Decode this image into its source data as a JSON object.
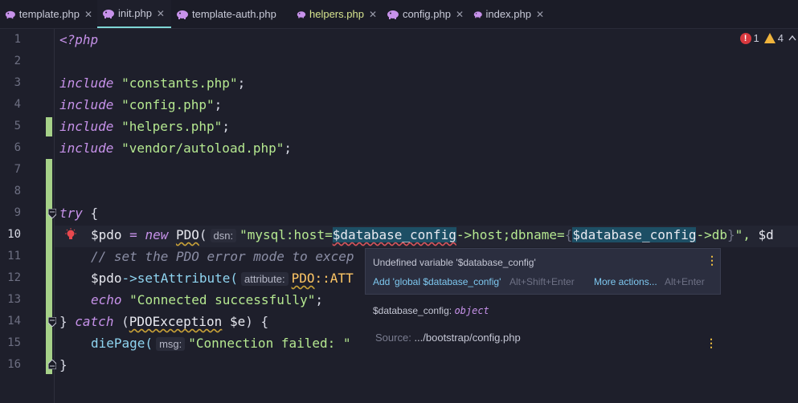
{
  "tabs": [
    {
      "label": "template.php",
      "active": false,
      "modified": false
    },
    {
      "label": "init.php",
      "active": true,
      "modified": false
    },
    {
      "label": "template-auth.php",
      "active": false,
      "modified": false
    },
    {
      "label": "helpers.php",
      "active": false,
      "modified": true
    },
    {
      "label": "config.php",
      "active": false,
      "modified": false
    },
    {
      "label": "index.php",
      "active": false,
      "modified": false
    }
  ],
  "tab_close_glyph": "✕",
  "line_numbers": [
    "1",
    "2",
    "3",
    "4",
    "5",
    "6",
    "7",
    "8",
    "9",
    "10",
    "11",
    "12",
    "13",
    "14",
    "15",
    "16"
  ],
  "code": {
    "l1": "<?php",
    "l3_kw": "include",
    "l3_str": "\"constants.php\"",
    "semi": ";",
    "l4_kw": "include",
    "l4_str": "\"config.php\"",
    "l5_kw": "include",
    "l5_str": "\"helpers.php\"",
    "l6_kw": "include",
    "l6_str": "\"vendor/autoload.php\"",
    "l9_kw": "try",
    "l9_brace": " {",
    "l10_var": "$pdo",
    "l10_eq": " = ",
    "l10_new": "new",
    "l10_cls": "PDO",
    "l10_paren": "(",
    "l10_hint": "dsn:",
    "l10_str1": "\"mysql:host=",
    "l10_var2": "$database_config",
    "l10_arrow1": "->host;dbname=",
    "l10_brace_open": "{",
    "l10_var3": "$database_config",
    "l10_arrow2": "->db",
    "l10_brace_close": "}",
    "l10_str_end": "\", ",
    "l10_tail": "$d",
    "l11_comment": "// set the PDO error mode to excep",
    "l12_var": "$pdo",
    "l12_method": "->setAttribute(",
    "l12_hint": "attribute:",
    "l12_cls": "PDO",
    "l12_rest": "::ATT",
    "l13_echo": "echo",
    "l13_str": "\"Connected successfully\"",
    "l14_close": "}",
    "l14_catch": "catch",
    "l14_open": " (",
    "l14_cls": "PDOException",
    "l14_var": "$e",
    "l14_end": ") {",
    "l15_fn": "diePage(",
    "l15_hint": "msg:",
    "l15_str": "\"Connection failed: \"",
    "l16_close": "}"
  },
  "indicators": {
    "errors": "1",
    "warnings": "4",
    "error_glyph": "!"
  },
  "popup": {
    "title": "Undefined variable '$database_config'",
    "fix_label": "Add 'global $database_config'",
    "fix_shortcut": "Alt+Shift+Enter",
    "more_label": "More actions...",
    "more_shortcut": "Alt+Enter",
    "kebab": "⋮"
  },
  "doc": {
    "signature_name": "$database_config:",
    "signature_type": "object",
    "source_label": "Source:",
    "source_path": ".../bootstrap/config.php",
    "kebab": "⋮"
  },
  "colors": {
    "background": "#1e1f2b",
    "accent_tab": "#7fd6d6",
    "change_bar": "#a6d189",
    "error": "#d8383e",
    "warning": "#f0b43c",
    "php_icon": "#c792ea"
  }
}
